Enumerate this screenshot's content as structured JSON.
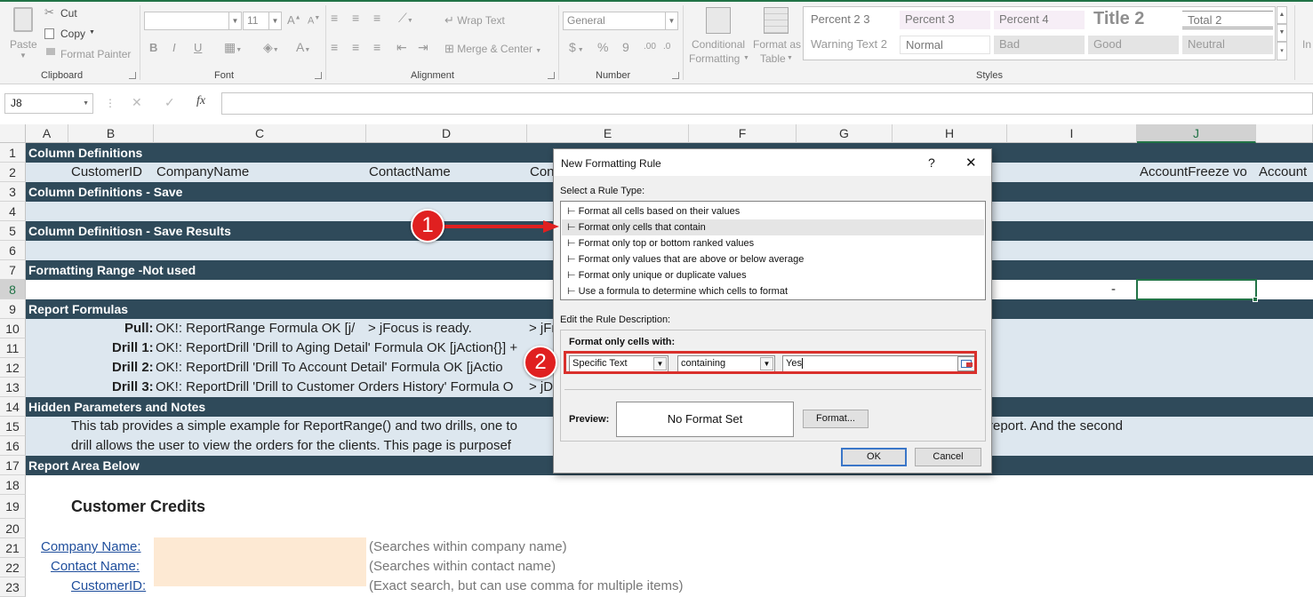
{
  "ribbon": {
    "clipboard": {
      "paste": "Paste",
      "cut": "Cut",
      "copy": "Copy",
      "format_painter": "Format Painter",
      "group": "Clipboard"
    },
    "font": {
      "size": "11",
      "group": "Font",
      "bold": "B",
      "italic": "I",
      "underline": "U"
    },
    "alignment": {
      "wrap_text": "Wrap Text",
      "merge_center": "Merge & Center",
      "group": "Alignment"
    },
    "number": {
      "format": "General",
      "currency": "$",
      "percent": "%",
      "comma": "9",
      "group": "Number"
    },
    "styles": {
      "conditional_formatting_1": "Conditional",
      "conditional_formatting_2": "Formatting",
      "format_as_table_1": "Format as",
      "format_as_table_2": "Table",
      "group": "Styles",
      "cells": [
        "Percent 2 3",
        "Percent 3",
        "Percent 4",
        "Title 2",
        "Total 2",
        "Warning Text 2",
        "Normal",
        "Bad",
        "Good",
        "Neutral"
      ]
    },
    "insert_partial": "In"
  },
  "formula_bar": {
    "name_box": "J8",
    "fx": "fx",
    "value": ""
  },
  "columns": [
    "A",
    "B",
    "C",
    "D",
    "E",
    "F",
    "G",
    "H",
    "I",
    "J"
  ],
  "rows": [
    "1",
    "2",
    "3",
    "4",
    "5",
    "6",
    "7",
    "8",
    "9",
    "10",
    "11",
    "12",
    "13",
    "14",
    "15",
    "16",
    "17",
    "18",
    "19",
    "20",
    "21",
    "22",
    "23"
  ],
  "sheet": {
    "r1": "Column Definitions",
    "r2_b": "CustomerID",
    "r2_c": "CompanyName",
    "r2_d": "ContactName",
    "r2_e": "Con",
    "r2_j": "AccountFreeze vo",
    "r2_k": "Account",
    "r3": "Column Definitions - Save",
    "r5": "Column Definitiosn - Save Results",
    "r7": "Formatting Range -Not used",
    "r8_i": "-",
    "r9": "Report Formulas",
    "r10_label": "Pull:",
    "r10_text": "OK!: ReportRange Formula OK [j/",
    "r10_c2": "> jFocus is ready.",
    "r10_e": "> jFr",
    "r11_label": "Drill 1:",
    "r11_text": "OK!: ReportDrill 'Drill to Aging Detail' Formula OK [jAction{}] +",
    "r12_label": "Drill 2:",
    "r12_text": "OK!: ReportDrill 'Drill To Account Detail' Formula OK [jActio",
    "r13_label": "Drill 3:",
    "r13_text": "OK!: ReportDrill 'Drill to Customer Orders History' Formula O",
    "r13_d": "> jD",
    "r14": "Hidden Parameters and Notes",
    "r15_left": "This tab provides a simple example for ReportRange() and two drills, one to",
    "r15_right": "report. And the second",
    "r16_left": "drill allows the user to view the orders for the clients.   This page is purposef",
    "r17": "Report Area Below",
    "r19": "Customer Credits",
    "r21_label": "Company Name:",
    "r21_note": "(Searches within company name)",
    "r22_label": "Contact Name:",
    "r22_note": "(Searches within contact name)",
    "r23_label": "CustomerID:",
    "r23_note": "(Exact search, but can use comma for multiple items)"
  },
  "dialog": {
    "title": "New Formatting Rule",
    "help": "?",
    "close": "✕",
    "select_rule_type": "Select a Rule Type:",
    "rules": [
      "⊢ Format all cells based on their values",
      "⊢ Format only cells that contain",
      "⊢ Format only top or bottom ranked values",
      "⊢ Format only values that are above or below average",
      "⊢ Format only unique or duplicate values",
      "⊢ Use a formula to determine which cells to format"
    ],
    "edit_description": "Edit the Rule Description:",
    "format_only_cells_with": "Format only cells with:",
    "condition_type": "Specific Text",
    "operator": "containing",
    "value": "Yes",
    "preview_label": "Preview:",
    "preview_text": "No Format Set",
    "format_button": "Format...",
    "ok": "OK",
    "cancel": "Cancel"
  },
  "annotations": {
    "badge1": "1",
    "badge2": "2"
  },
  "colors": {
    "header_band": "#2f4a5a",
    "light_band": "#dde7ef",
    "input_cell": "#fde9d3",
    "annotation": "#e02020",
    "excel_green": "#217346"
  }
}
